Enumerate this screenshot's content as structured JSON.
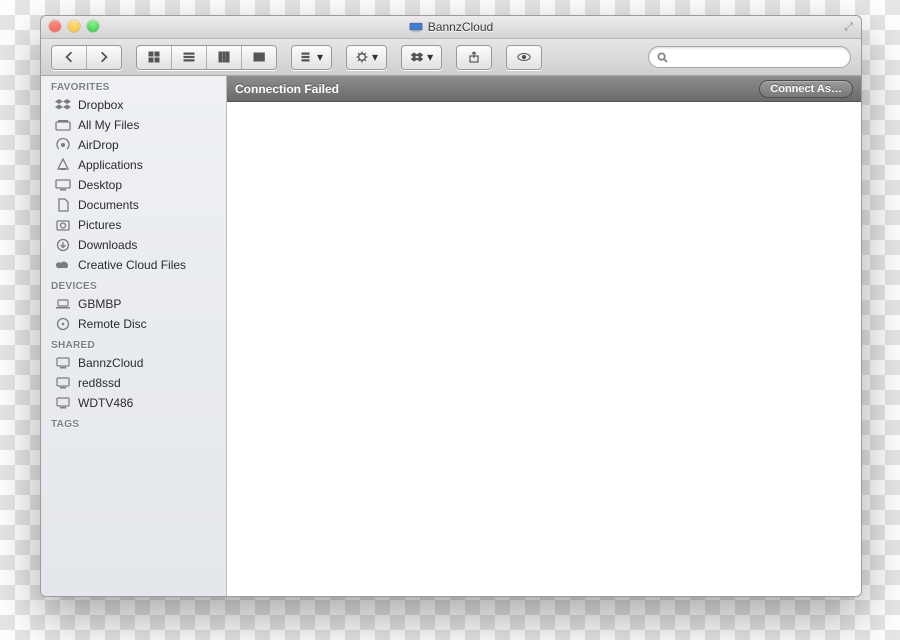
{
  "window": {
    "title": "BannzCloud"
  },
  "search": {
    "placeholder": ""
  },
  "statusbar": {
    "message": "Connection Failed",
    "button": "Connect As…"
  },
  "sidebar": {
    "sections": [
      {
        "header": "FAVORITES",
        "items": [
          {
            "label": "Dropbox"
          },
          {
            "label": "All My Files"
          },
          {
            "label": "AirDrop"
          },
          {
            "label": "Applications"
          },
          {
            "label": "Desktop"
          },
          {
            "label": "Documents"
          },
          {
            "label": "Pictures"
          },
          {
            "label": "Downloads"
          },
          {
            "label": "Creative Cloud Files"
          }
        ]
      },
      {
        "header": "DEVICES",
        "items": [
          {
            "label": "GBMBP"
          },
          {
            "label": "Remote Disc"
          }
        ]
      },
      {
        "header": "SHARED",
        "items": [
          {
            "label": "BannzCloud"
          },
          {
            "label": "red8ssd"
          },
          {
            "label": "WDTV486"
          }
        ]
      },
      {
        "header": "TAGS",
        "items": []
      }
    ]
  }
}
